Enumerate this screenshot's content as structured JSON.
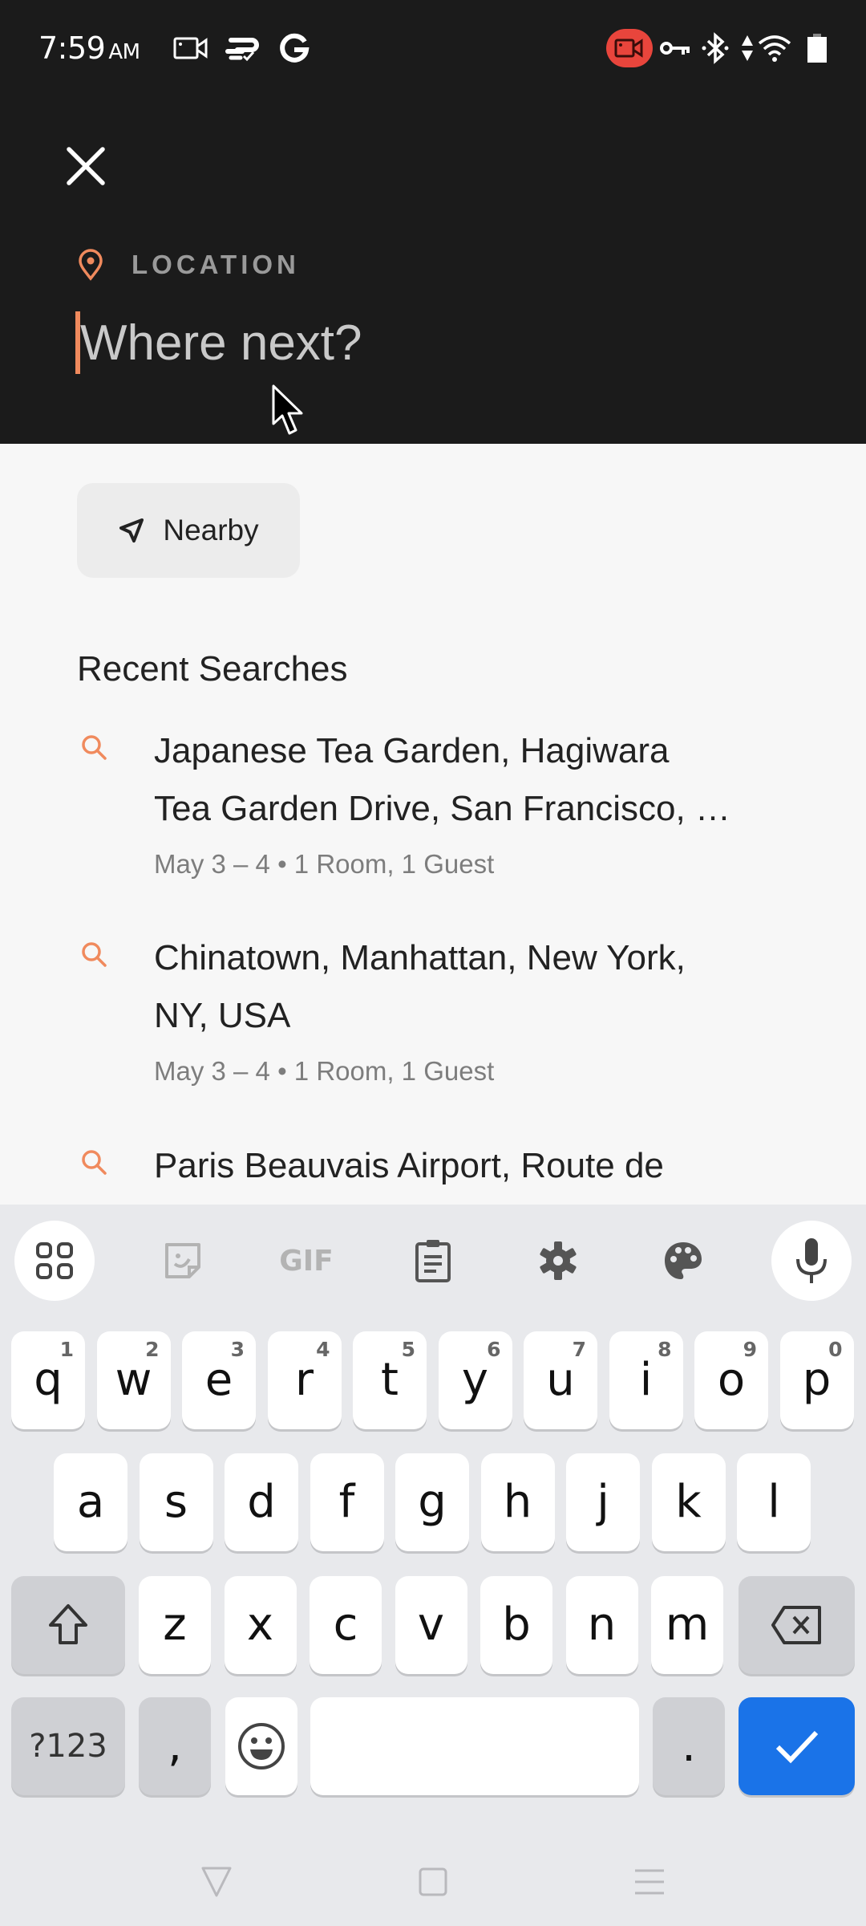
{
  "status_bar": {
    "time": "7:59",
    "ampm": "AM",
    "left_icons": [
      "screen-record-icon",
      "vpn-app-icon",
      "google-icon"
    ],
    "right_icons": [
      "recording-indicator-icon",
      "vpn-key-icon",
      "bluetooth-icon",
      "data-arrows-icon",
      "wifi-icon",
      "battery-icon"
    ],
    "recording_color": "#e8453c"
  },
  "header": {
    "close_icon": "close-icon",
    "location_label": "LOCATION",
    "location_icon": "map-pin-icon",
    "search_placeholder": "Where next?",
    "search_value": "",
    "accent_color": "#f08a5d"
  },
  "nearby": {
    "label": "Nearby",
    "icon": "navigation-arrow-icon"
  },
  "recent": {
    "title": "Recent Searches",
    "items": [
      {
        "line1": "Japanese Tea Garden, Hagiwara",
        "line2": "Tea Garden Drive, San Francisco, …",
        "meta": "May 3 – 4 • 1 Room, 1 Guest"
      },
      {
        "line1": "Chinatown, Manhattan, New York,",
        "line2": "NY, USA",
        "meta": "May 3 – 4 • 1 Room, 1 Guest"
      },
      {
        "line1": "Paris Beauvais Airport, Route de",
        "line2": "",
        "meta": ""
      }
    ]
  },
  "keyboard": {
    "toolbar": [
      "apps-grid-icon",
      "sticker-icon",
      "gif-icon",
      "clipboard-icon",
      "settings-gear-icon",
      "theme-palette-icon",
      "microphone-icon"
    ],
    "gif_label": "GIF",
    "row1": [
      {
        "k": "q",
        "h": "1"
      },
      {
        "k": "w",
        "h": "2"
      },
      {
        "k": "e",
        "h": "3"
      },
      {
        "k": "r",
        "h": "4"
      },
      {
        "k": "t",
        "h": "5"
      },
      {
        "k": "y",
        "h": "6"
      },
      {
        "k": "u",
        "h": "7"
      },
      {
        "k": "i",
        "h": "8"
      },
      {
        "k": "o",
        "h": "9"
      },
      {
        "k": "p",
        "h": "0"
      }
    ],
    "row2": [
      "a",
      "s",
      "d",
      "f",
      "g",
      "h",
      "j",
      "k",
      "l"
    ],
    "row3": [
      "z",
      "x",
      "c",
      "v",
      "b",
      "n",
      "m"
    ],
    "symbols_label": "?123",
    "comma_label": ",",
    "period_label": ".",
    "enter_color": "#1a73e8"
  },
  "nav_bar": [
    "back-icon",
    "home-icon",
    "recents-icon"
  ]
}
